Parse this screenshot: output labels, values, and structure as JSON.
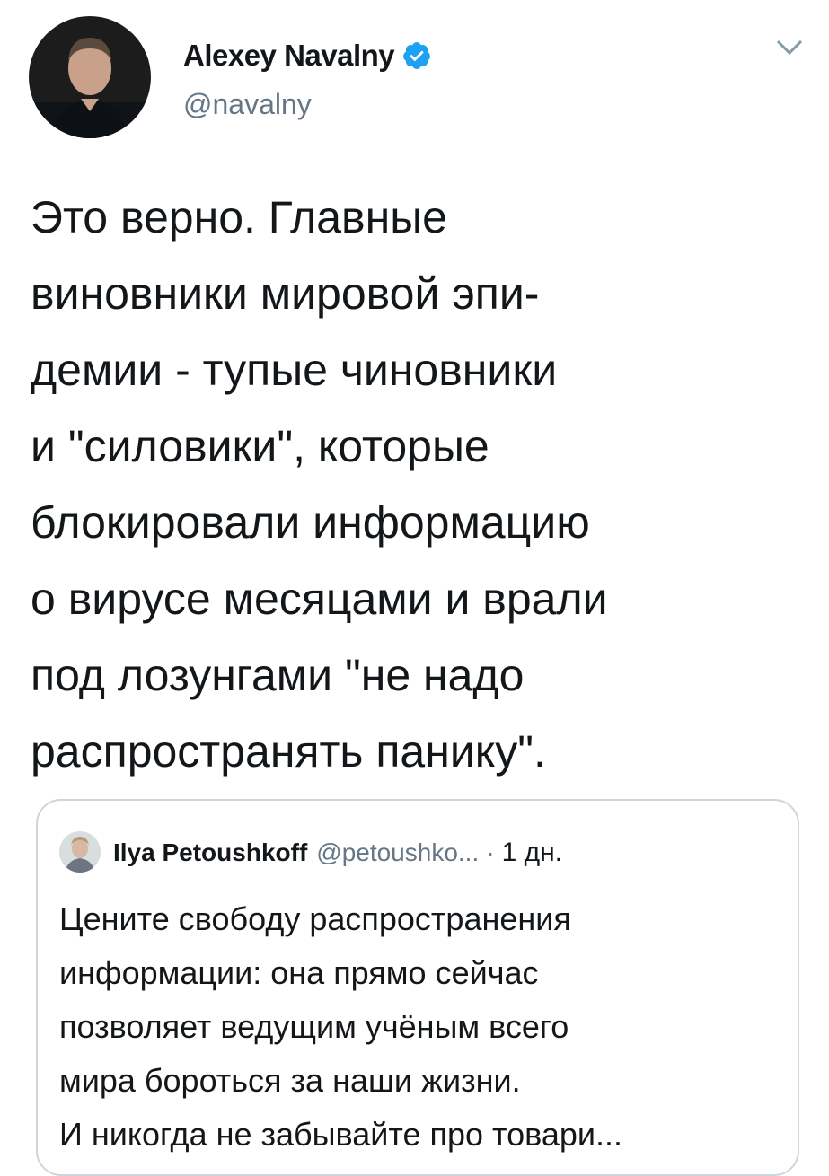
{
  "tweet": {
    "author_name": "Alexey Navalny",
    "author_handle": "@navalny",
    "verified": true,
    "icons": {
      "avatar": "avatar-photo",
      "verified": "verified-badge-icon",
      "menu": "chevron-down-icon"
    },
    "text_lines": [
      "Это верно. Главные",
      "виновники мировой эпи-",
      "демии - тупые чиновники",
      "и \"силовики\", которые",
      "блокировали информацию",
      "о вирусе месяцами и врали",
      "под лозунгами \"не надо",
      "распространять панику\"."
    ]
  },
  "quoted_tweet": {
    "author_name": "Ilya Petoushkoff",
    "author_handle": "@petoushko...",
    "separator": "·",
    "time": "1 дн.",
    "text_lines": [
      "Цените свободу распространения",
      "информации: она прямо сейчас",
      "позволяет ведущим учёным всего",
      "мира бороться за наши жизни.",
      "И никогда не забывайте про товари..."
    ]
  },
  "colors": {
    "text": "#14171a",
    "secondary_text": "#657786",
    "verified_blue": "#1da1f2",
    "border": "#ccd6dd"
  }
}
